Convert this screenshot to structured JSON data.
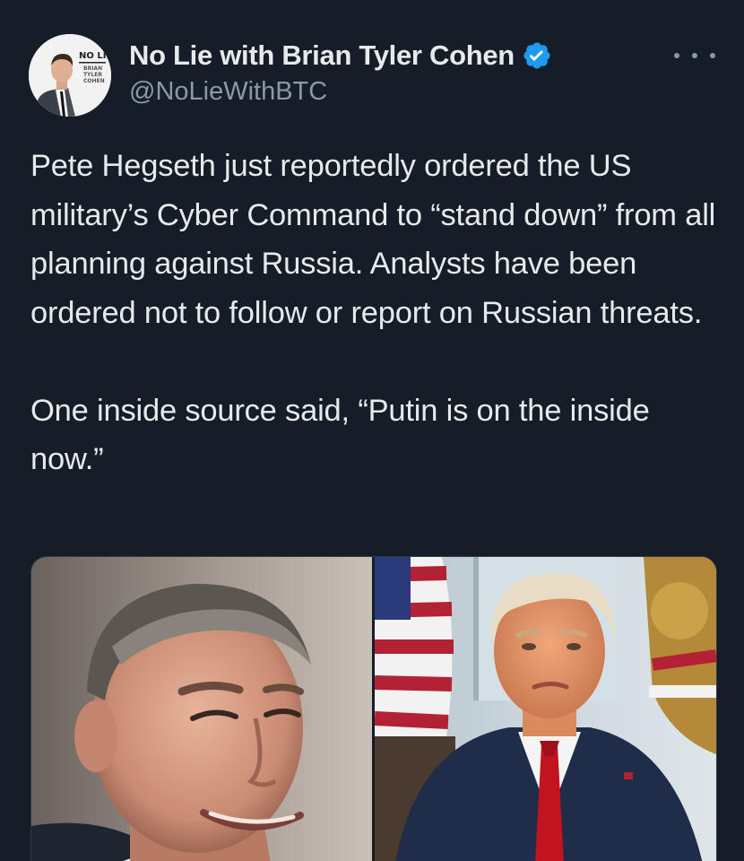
{
  "author": {
    "display_name": "No Lie with Brian Tyler Cohen",
    "handle": "@NoLieWithBTC",
    "verified": true,
    "avatar_badge": {
      "line1": "NO LIE",
      "line2": "BRIAN",
      "line3": "TYLER",
      "line4": "COHEN"
    }
  },
  "tweet": {
    "paragraphs": [
      "Pete Hegseth just reportedly ordered the US military’s Cyber Command to “stand down” from all planning against Russia. Analysts have been ordered not to follow or report on Russian threats.",
      "One inside source said, “Putin is on the inside now.”"
    ]
  },
  "media": {
    "images": [
      {
        "name": "left-photo",
        "icon": "man-smiling-portrait"
      },
      {
        "name": "right-photo",
        "icon": "man-in-suit-red-tie-with-flags"
      }
    ]
  },
  "colors": {
    "background": "#151d28",
    "text": "#e7e9ea",
    "secondary_text": "#8b98a5",
    "verified_blue": "#1d9bf0"
  },
  "icons": {
    "verified": "verified-badge-icon",
    "more": "more-options-icon"
  }
}
